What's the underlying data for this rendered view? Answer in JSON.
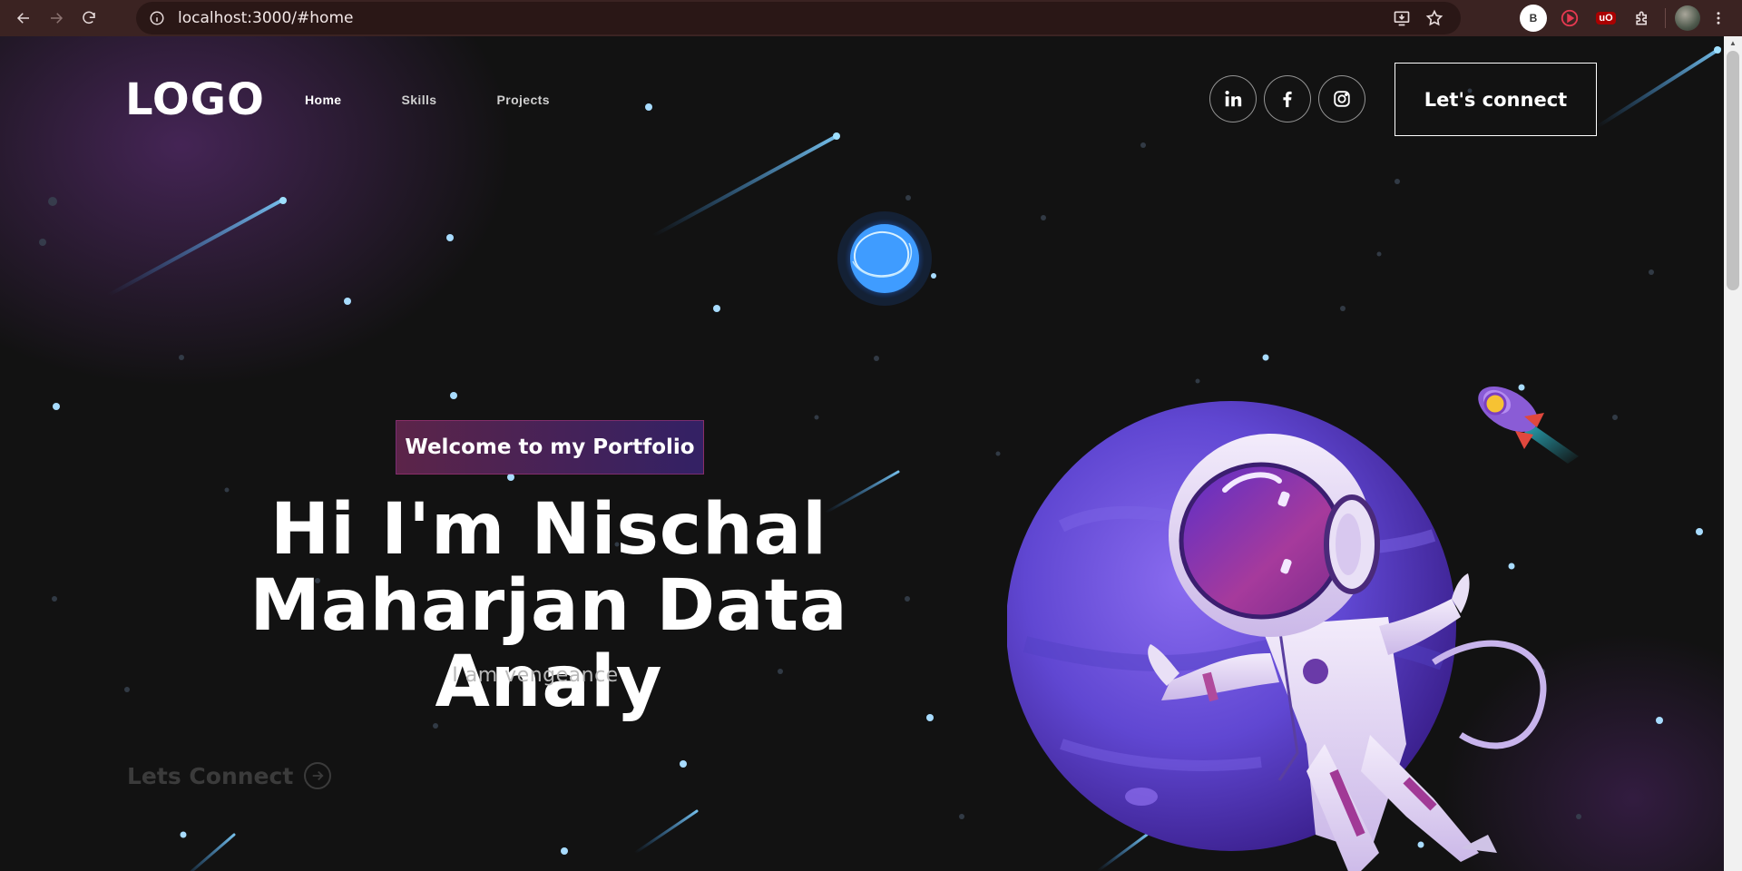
{
  "browser": {
    "url": "localhost:3000/#home",
    "extensions": {
      "profile_letter": "B",
      "ublock_label": "uO"
    }
  },
  "navbar": {
    "logo": "LOGO",
    "links": [
      {
        "label": "Home",
        "active": true
      },
      {
        "label": "Skills",
        "active": false
      },
      {
        "label": "Projects",
        "active": false
      }
    ],
    "socials": [
      "linkedin-icon",
      "facebook-icon",
      "instagram-icon"
    ],
    "connect_label": "Let's connect"
  },
  "hero": {
    "tagline": "Welcome to my Portfolio",
    "title_line1": "Hi I'm Nischal",
    "title_line2": "Maharjan Data Analy",
    "subtitle": "I am vengeance",
    "cta_label": "Lets Connect"
  },
  "colors": {
    "background": "#121212",
    "chrome": "#3b2322",
    "accent_pink": "#aa367c",
    "accent_purple": "#4a2fbd",
    "planet": "#6b4fd8"
  }
}
